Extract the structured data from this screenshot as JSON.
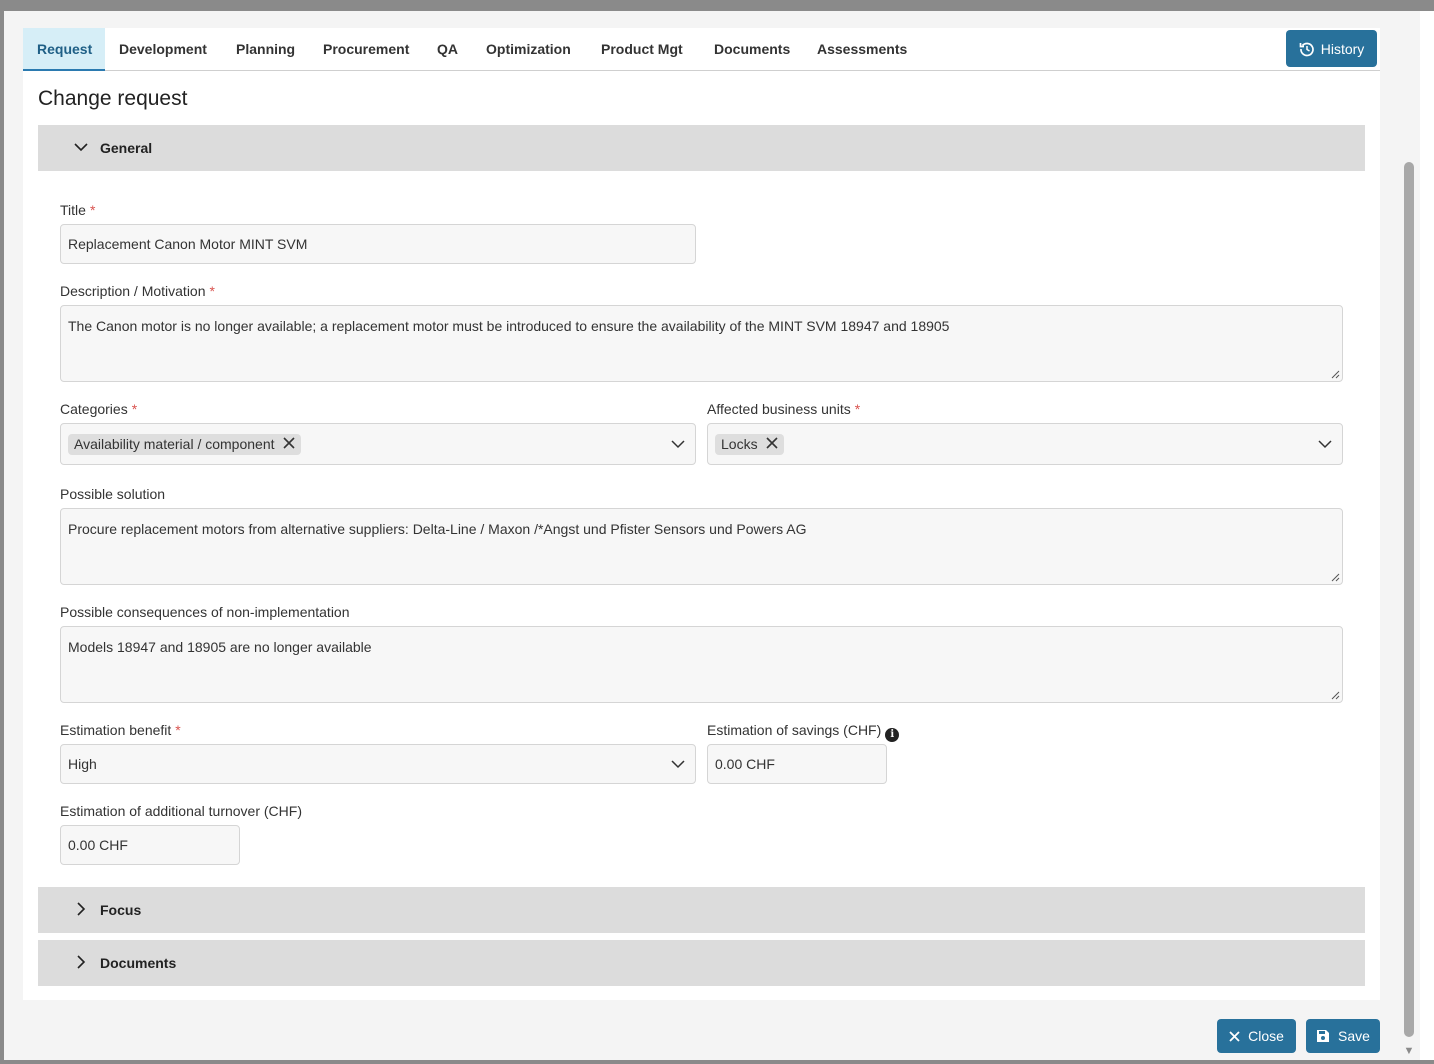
{
  "tabs": [
    {
      "label": "Request",
      "active": true
    },
    {
      "label": "Development"
    },
    {
      "label": "Planning"
    },
    {
      "label": "Procurement"
    },
    {
      "label": "QA"
    },
    {
      "label": "Optimization"
    },
    {
      "label": "Product Mgt"
    },
    {
      "label": "Documents"
    },
    {
      "label": "Assessments"
    }
  ],
  "history_label": "History",
  "page_title": "Change request",
  "sections": {
    "general": "General",
    "focus": "Focus",
    "documents": "Documents"
  },
  "form": {
    "title": {
      "label": "Title",
      "required_mark": "*",
      "value": "Replacement Canon Motor MINT SVM"
    },
    "description": {
      "label": "Description / Motivation",
      "required_mark": "*",
      "value": "The Canon motor is no longer available; a replacement motor must be introduced to ensure the availability of the MINT SVM 18947 and 18905"
    },
    "categories": {
      "label": "Categories",
      "required_mark": "*",
      "chips": [
        "Availability material / component"
      ]
    },
    "business_units": {
      "label": "Affected business units",
      "required_mark": "*",
      "chips": [
        "Locks"
      ]
    },
    "possible_solution": {
      "label": "Possible solution",
      "value": "Procure replacement motors from alternative suppliers: Delta-Line / Maxon /*Angst und Pfister Sensors und Powers AG"
    },
    "consequences": {
      "label": "Possible consequences of non-implementation",
      "value": "Models 18947 and 18905 are no longer available"
    },
    "estimation_benefit": {
      "label": "Estimation benefit",
      "required_mark": "*",
      "value": "High"
    },
    "estimation_savings": {
      "label": "Estimation of savings (CHF)",
      "value": "0.00 CHF"
    },
    "additional_turnover": {
      "label": "Estimation of additional turnover (CHF)",
      "value": "0.00 CHF"
    }
  },
  "footer": {
    "close_label": "Close",
    "save_label": "Save"
  },
  "colors": {
    "primary": "#28719b",
    "active_tab_bg": "#d6eef7",
    "section_bg": "#dcdcdc",
    "required": "#d9534f"
  }
}
